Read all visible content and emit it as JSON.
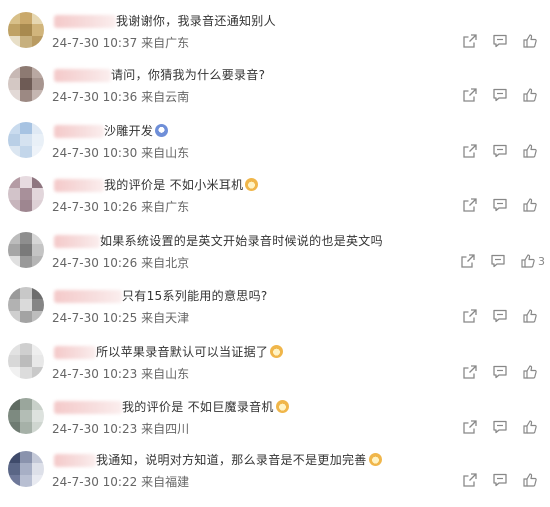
{
  "comments": [
    {
      "text": "我谢谢你，我录音还通知别人",
      "time": "24-7-30 10:37",
      "location": "来自广东",
      "emoji": null,
      "like_count": "",
      "avatar_colors": [
        "#d8c089",
        "#c9a86a",
        "#e6d7b1",
        "#bfa265",
        "#a88a4f",
        "#d1b57c",
        "#e8dfc7",
        "#c7b07e",
        "#b99b62"
      ]
    },
    {
      "text": "请问，你猜我为什么要录音?",
      "time": "24-7-30 10:36",
      "location": "来自云南",
      "emoji": null,
      "like_count": "",
      "avatar_colors": [
        "#c7b8b4",
        "#8d7a72",
        "#b9a8a2",
        "#d4c8c4",
        "#6e5b55",
        "#a7958f",
        "#e2d9d6",
        "#9c8983",
        "#c5b6b1"
      ]
    },
    {
      "text": "沙雕开发",
      "time": "24-7-30 10:30",
      "location": "来自山东",
      "emoji": "blue",
      "like_count": "",
      "avatar_colors": [
        "#c9dbee",
        "#a7c3e2",
        "#dfe9f4",
        "#b9cfe6",
        "#d5e2f0",
        "#e9f0f7",
        "#dbe6f1",
        "#c3d6ea",
        "#eef3f9"
      ]
    },
    {
      "text": "我的评价是  不如小米耳机",
      "time": "24-7-30 10:26",
      "location": "来自广东",
      "emoji": "cat",
      "like_count": "",
      "avatar_colors": [
        "#b49ba4",
        "#e7dbe0",
        "#8f7680",
        "#d2c3c9",
        "#a8909a",
        "#e2d6db",
        "#c7b5bc",
        "#9e8690",
        "#ddd0d5"
      ]
    },
    {
      "text": "如果系统设置的是英文开始录音时候说的也是英文吗",
      "time": "24-7-30 10:26",
      "location": "来自北京",
      "emoji": null,
      "like_count": "3",
      "avatar_colors": [
        "#bcbcbc",
        "#8e8e8e",
        "#d6d6d6",
        "#a6a6a6",
        "#7a7a7a",
        "#c4c4c4",
        "#e0e0e0",
        "#999999",
        "#b5b5b5"
      ]
    },
    {
      "text": "只有15系列能用的意思吗?",
      "time": "24-7-30 10:25",
      "location": "来自天津",
      "emoji": null,
      "like_count": "",
      "avatar_colors": [
        "#9b9b9b",
        "#c8c8c8",
        "#6d6d6d",
        "#b2b2b2",
        "#dadada",
        "#858585",
        "#cfcfcf",
        "#a3a3a3",
        "#bdbdbd"
      ]
    },
    {
      "text": "所以苹果录音默认可以当证据了",
      "time": "24-7-30 10:23",
      "location": "来自山东",
      "emoji": "cat",
      "like_count": "",
      "avatar_colors": [
        "#e2e2e2",
        "#cfcfcf",
        "#eeeeee",
        "#d8d8d8",
        "#bcbcbc",
        "#e8e8e8",
        "#f1f1f1",
        "#dcdcdc",
        "#c9c9c9"
      ]
    },
    {
      "text": "我的评价是 不如巨魔录音机",
      "time": "24-7-30 10:23",
      "location": "来自四川",
      "emoji": "cat",
      "like_count": "",
      "avatar_colors": [
        "#5f6b62",
        "#9aa69c",
        "#c8d0c9",
        "#7d8a80",
        "#b3bdb5",
        "#dde2de",
        "#6f7b72",
        "#a6b1a8",
        "#cfd6d0"
      ]
    },
    {
      "text": "我通知，说明对方知道，那么录音是不是更加完善",
      "time": "24-7-30 10:22",
      "location": "来自福建",
      "emoji": "cat",
      "like_count": "",
      "avatar_colors": [
        "#3f4b6b",
        "#8a93ad",
        "#c4c9d8",
        "#5a6686",
        "#a7afc5",
        "#dde0e9",
        "#6e7899",
        "#b8bfd2",
        "#e8eaf1"
      ]
    }
  ],
  "icons": {
    "share": "share-icon",
    "comment": "comment-icon",
    "like": "like-icon"
  },
  "colors": {
    "text": "#333333",
    "meta": "#666666",
    "icon": "#888888",
    "name_blur": "#f4c9c9"
  }
}
